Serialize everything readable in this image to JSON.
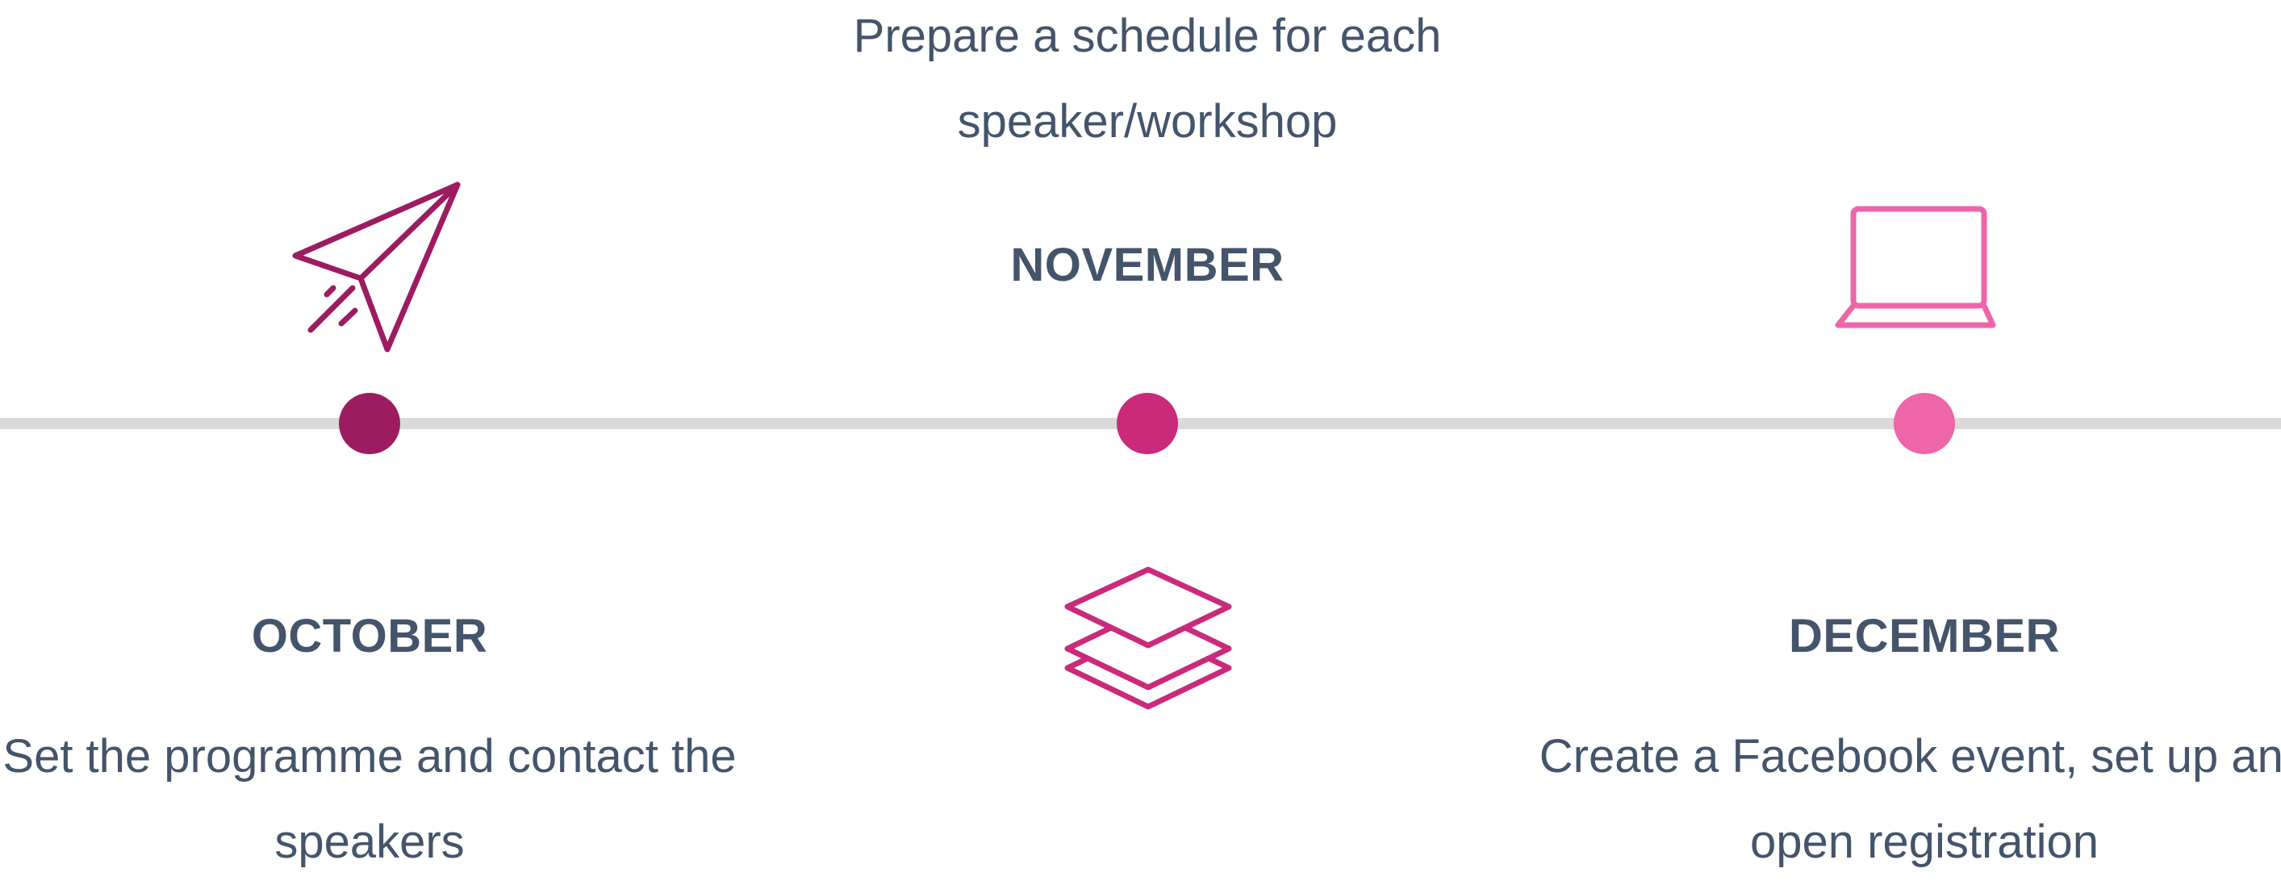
{
  "colors": {
    "october": "#9c1b61",
    "november": "#ca2a7c",
    "december": "#ee65a9",
    "text": "#44546a",
    "line": "#dadada"
  },
  "milestones": [
    {
      "month": "OCTOBER",
      "description": "Set the programme and contact the speakers",
      "icon": "paper-plane-icon"
    },
    {
      "month": "NOVEMBER",
      "description": "Prepare a schedule for each speaker/workshop",
      "icon": "layers-icon"
    },
    {
      "month": "DECEMBER",
      "description": "Create a Facebook event, set up and open registration",
      "icon": "laptop-icon"
    }
  ]
}
